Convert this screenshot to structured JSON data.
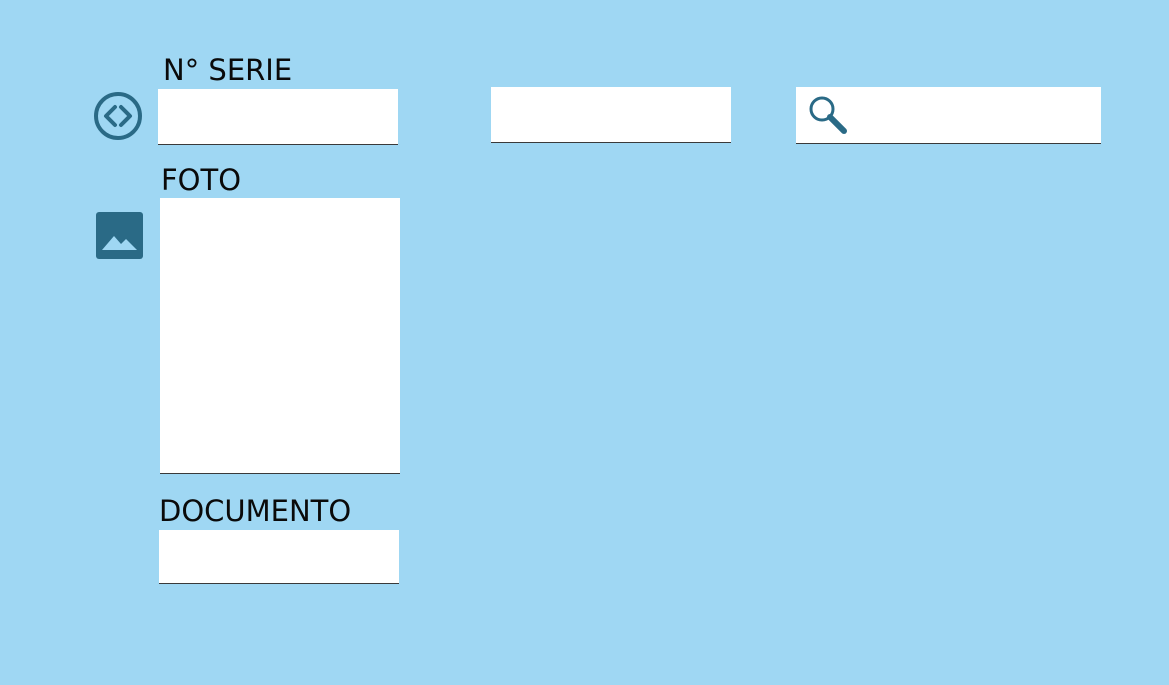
{
  "colors": {
    "background": "#9fd7f3",
    "field": "#ffffff",
    "icon": "#2a6a86"
  },
  "serial": {
    "label": "N° SERIE",
    "value": "",
    "icon": "code-circle-icon"
  },
  "extra_field": {
    "value": ""
  },
  "search": {
    "value": "",
    "icon": "search-icon"
  },
  "photo": {
    "label": "FOTO",
    "icon": "image-icon"
  },
  "document": {
    "label": "DOCUMENTO",
    "value": ""
  }
}
